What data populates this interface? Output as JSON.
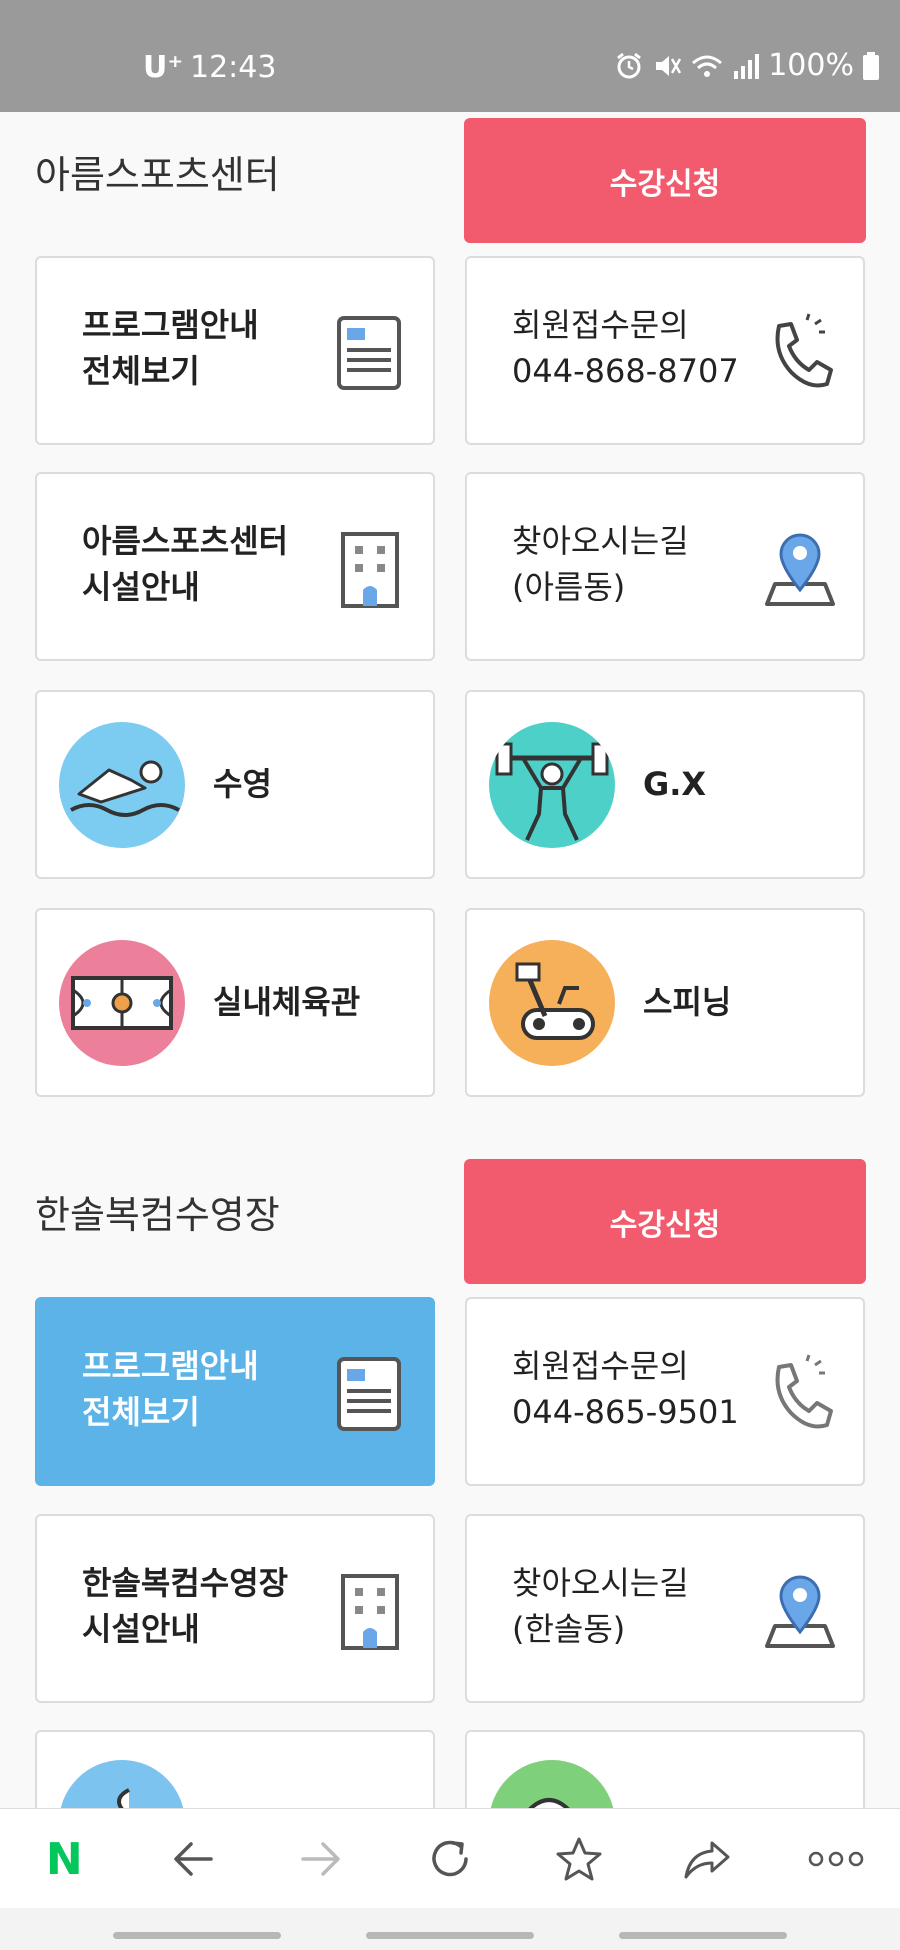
{
  "status_bar": {
    "carrier": "U⁺",
    "time": "12:43",
    "battery": "100%"
  },
  "sections": [
    {
      "title": "아름스포츠센터",
      "enroll_label": "수강신청",
      "cards": [
        {
          "line1": "프로그램안내",
          "line2": "전체보기",
          "icon": "document-icon"
        },
        {
          "line1": "회원접수문의",
          "line2": "044-868-8707",
          "icon": "phone-icon"
        },
        {
          "line1": "아름스포츠센터",
          "line2": "시설안내",
          "icon": "building-icon"
        },
        {
          "line1": "찾아오시는길",
          "line2": "(아름동)",
          "icon": "map-pin-icon"
        },
        {
          "label": "수영",
          "icon": "swimming-icon"
        },
        {
          "label": "G.X",
          "icon": "weightlifting-icon"
        },
        {
          "label": "실내체육관",
          "icon": "basketball-court-icon"
        },
        {
          "label": "스피닝",
          "icon": "spinning-bike-icon"
        }
      ]
    },
    {
      "title": "한솔복컴수영장",
      "enroll_label": "수강신청",
      "cards": [
        {
          "line1": "프로그램안내",
          "line2": "전체보기",
          "icon": "document-icon"
        },
        {
          "line1": "회원접수문의",
          "line2": "044-865-9501",
          "icon": "phone-icon"
        },
        {
          "line1": "한솔복컴수영장",
          "line2": "시설안내",
          "icon": "building-icon"
        },
        {
          "line1": "찾아오시는길",
          "line2": "(한솔동)",
          "icon": "map-pin-icon"
        }
      ]
    }
  ],
  "toolbar": {
    "items": [
      "naver-logo-icon",
      "back-icon",
      "forward-icon",
      "refresh-icon",
      "bookmark-star-icon",
      "share-icon",
      "more-icon"
    ],
    "logo_text": "N"
  },
  "colors": {
    "enroll": "#f25a6e",
    "active_card": "#5bb3e8",
    "naver_green": "#03c75a"
  }
}
